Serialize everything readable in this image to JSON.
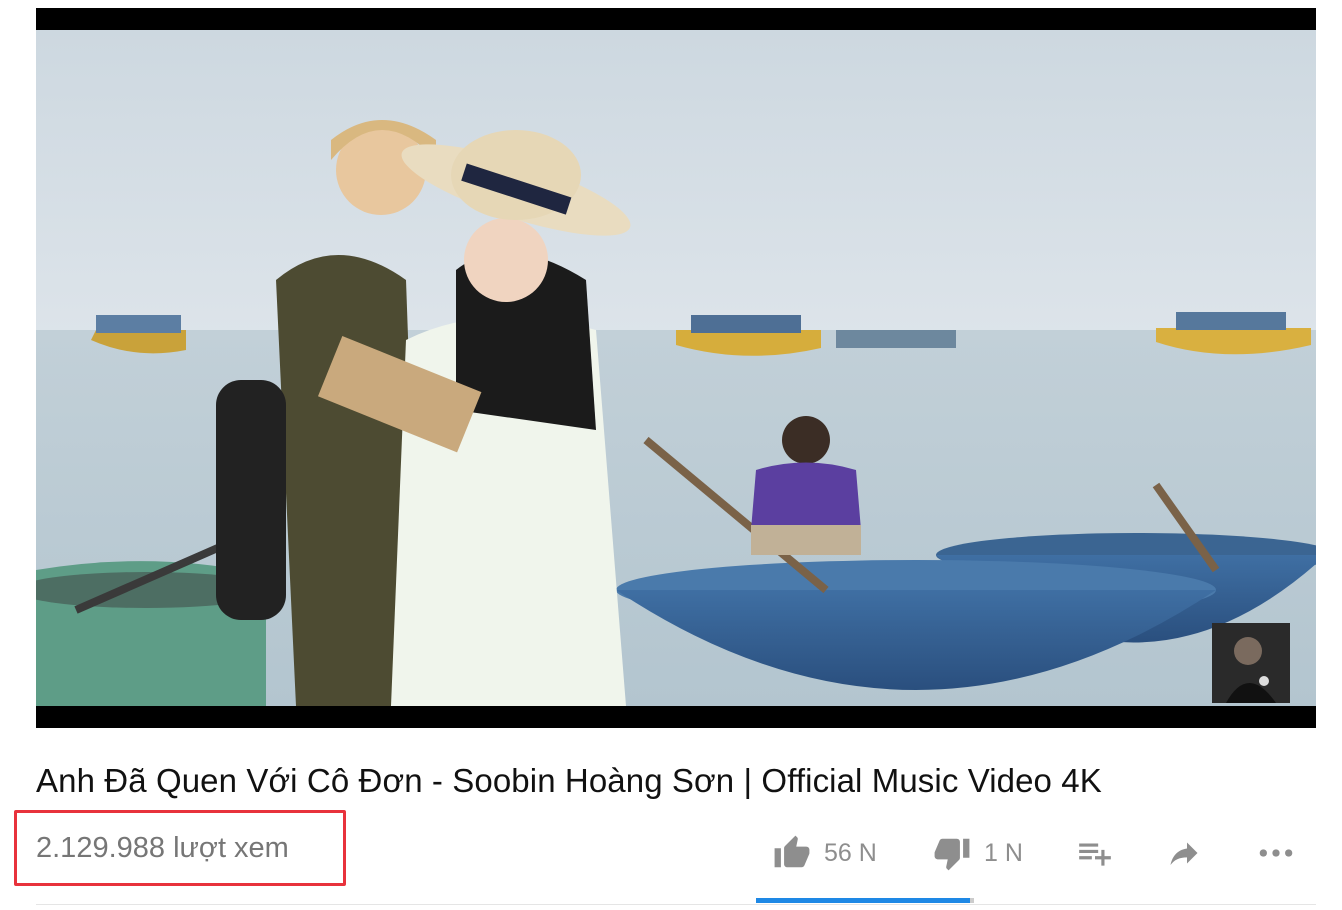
{
  "video": {
    "title": "Anh Đã Quen Với Cô Đơn - Soobin Hoàng Sơn | Official Music Video 4K",
    "views": "2.129.988 lượt xem",
    "like_count": "56 N",
    "dislike_count": "1 N",
    "like_ratio": 0.98
  },
  "icons": {
    "like": "thumbs-up-icon",
    "dislike": "thumbs-down-icon",
    "add_to_playlist": "playlist-add-icon",
    "share": "share-icon",
    "more": "more-horiz-icon"
  },
  "colors": {
    "highlight_box": "#e8323c",
    "sentiment_bar": "#1e88e5",
    "icon_gray": "#8e8e8e"
  }
}
